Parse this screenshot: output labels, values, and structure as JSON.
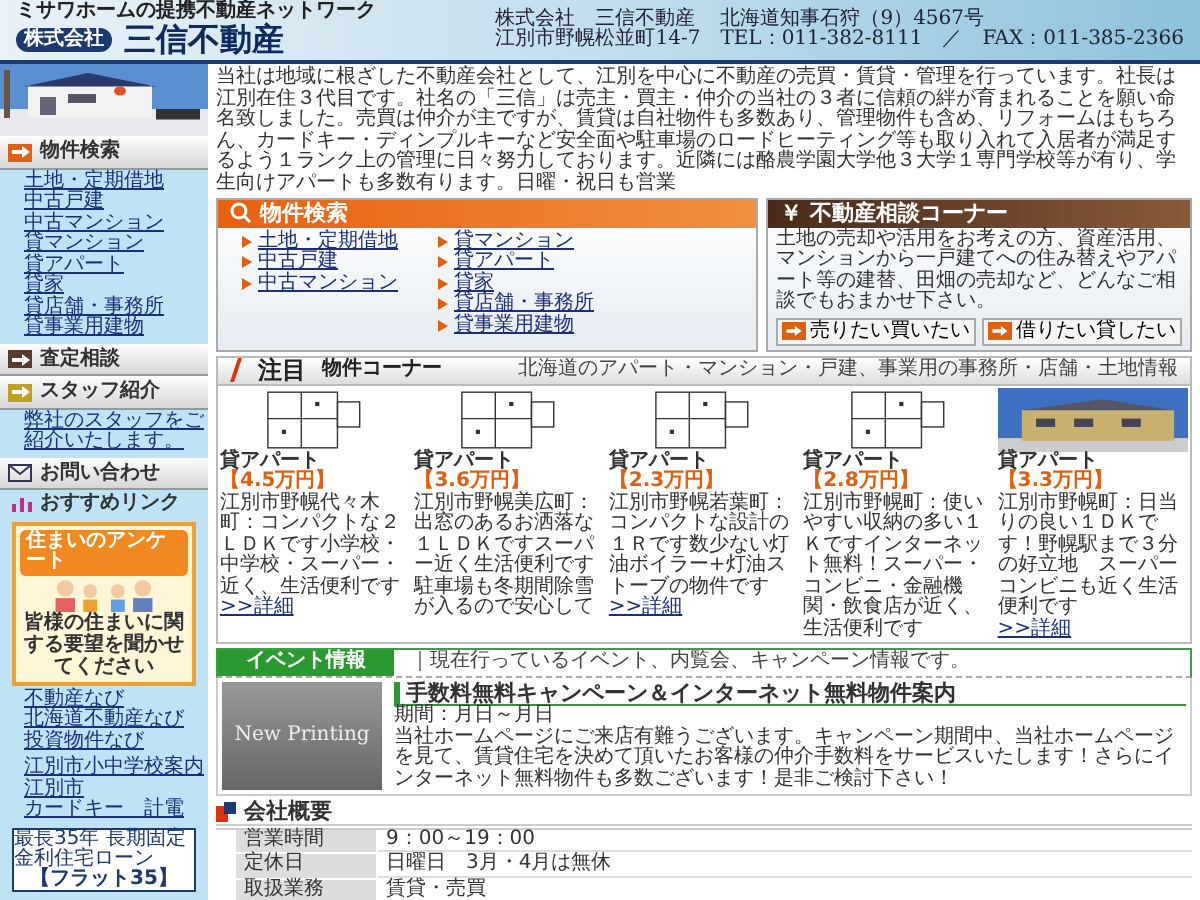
{
  "header": {
    "tagline": "ミサワホームの提携不動産ネットワーク",
    "logo_prefix": "株式会社",
    "logo_name": "三信不動産",
    "info": [
      "株式会社　三信不動産",
      "北海道知事石狩（9）4567号",
      "江別市野幌松並町14-7",
      "TEL：011-382-8111　／　FAX：011-385-2366"
    ]
  },
  "sidebar": {
    "search": {
      "title": "物件検索",
      "links": [
        "土地・定期借地",
        "中古戸建",
        "中古マンション",
        "貸マンション",
        "貸アパート",
        "貸家",
        "貸店舗・事務所",
        "貸事業用建物"
      ]
    },
    "appraisal": {
      "title": "査定相談"
    },
    "staff": {
      "title": "スタッフ紹介",
      "link": "弊社のスタッフをご紹介いたします。"
    },
    "contact": {
      "title": "お問い合わせ"
    },
    "recommend": {
      "title": "おすすめリンク"
    },
    "survey": {
      "title": "住まいのアンケート",
      "message": "皆様の住まいに関する要望を聞かせてください"
    },
    "link_groups": [
      [
        "不動産なび",
        "北海道不動産なび",
        "投資物件なび"
      ],
      [
        "江別市小中学校案内",
        "江別市",
        "カードキー　計電"
      ]
    ],
    "flat35": {
      "caption": "最長35年 長期固定金利住宅ローン",
      "title": "【フラット35】"
    }
  },
  "intro": "当社は地域に根ざした不動産会社として、江別を中心に不動産の売買・賃貸・管理を行っています。社長は江別在住３代目です。社名の「三信」は売主・買主・仲介の当社の３者に信頼の絆が育まれることを願い命名致しました。売買は仲介が主ですが、賃貸は自社物件も多数あり、管理物件も含め、リフォームはもちろん、カードキー・ディンプルキーなど安全面や駐車場のロードヒーティング等も取り入れて入居者が満足するよう１ランク上の管理に日々努力しております。近隣には酪農学園大学他３大学１専門学校等が有り、学生向けアパートも多数有ります。日曜・祝日も営業",
  "search_panel": {
    "title": "物件検索",
    "columns": [
      [
        "土地・定期借地",
        "中古戸建",
        "中古マンション"
      ],
      [
        "貸マンション",
        "貸アパート",
        "貸家",
        "貸店舗・事務所",
        "貸事業用建物"
      ]
    ]
  },
  "consult_panel": {
    "title": "不動産相談コーナー",
    "symbol": "￥",
    "text": "土地の売却や活用をお考えの方、資産活用、マンションから一戸建てへの住み替えやアパート等の建替、田畑の売却など、どんなご相談でもおまかせ下さい。",
    "buttons": [
      "売りたい買いたい",
      "借りたい貸したい"
    ]
  },
  "featured": {
    "title_main": "注目",
    "title_sub": "物件コーナー",
    "caption": "北海道のアパート・マンション・戸建、事業用の事務所・店舗・土地情報",
    "items": [
      {
        "kind": "floorplan",
        "type": "貸アパート",
        "price": "【4.5万円】",
        "desc": "江別市野幌代々木町：コンパクトな２ＬＤＫです小学校・中学校・スーパー・近く、生活便利です",
        "more": ">>詳細"
      },
      {
        "kind": "floorplan",
        "type": "貸アパート",
        "price": "【3.6万円】",
        "desc": "江別市野幌美広町：出窓のあるお洒落な１ＬＤＫですスーパー近く生活便利です駐車場も冬期間除雪が入るので安心して"
      },
      {
        "kind": "floorplan",
        "type": "貸アパート",
        "price": "【2.3万円】",
        "desc": "江別市野幌若葉町：コンパクトな設計の１Ｒです数少ない灯油ボイラー+灯油ストーブの物件です",
        "more": ">>詳細"
      },
      {
        "kind": "floorplan",
        "type": "貸アパート",
        "price": "【2.8万円】",
        "desc": "江別市野幌町：使いやすい収納の多い１Ｋですインターネット無料！スーパー・コンビニ・金融機関・飲食店が近く、生活便利です"
      },
      {
        "type": "貸アパート",
        "price": "【3.3万円】",
        "desc": "江別市野幌町：日当りの良い１ＤＫです！野幌駅まで３分の好立地　スーパーコンビニも近く生活便利です",
        "more": ">>詳細"
      }
    ]
  },
  "events": {
    "title": "イベント情報",
    "caption": "｜現在行っているイベント、内覧会、キャンペーン情報です。",
    "image_text": "New Printing",
    "headline": "手数料無料キャンペーン＆インターネット無料物件案内",
    "period": "期間：月日～月日",
    "body": "当社ホームページにご来店有難うございます。キャンペーン期間中、当社ホームページを見て、賃貸住宅を決めて頂いたお客様の仲介手数料をサービスいたします！さらにインターネット無料物件も多数ございます！是非ご検討下さい！"
  },
  "company": {
    "title": "会社概要",
    "rows": [
      {
        "label": "営業時間",
        "value": "9：00～19：00"
      },
      {
        "label": "定休日",
        "value": "日曜日　3月・4月は無休"
      },
      {
        "label": "取扱業務",
        "value": "賃貸・売買"
      }
    ]
  }
}
